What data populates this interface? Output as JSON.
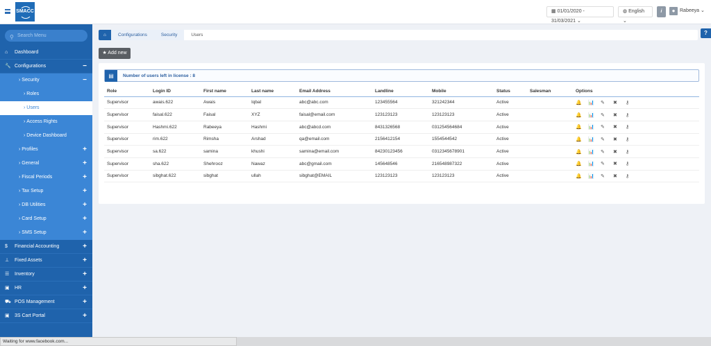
{
  "header": {
    "logo": "SMACC",
    "date_range": "01/01/2020 - 31/03/2021",
    "language": "English",
    "info": "i",
    "user": "Rabeeya"
  },
  "sidebar": {
    "search_placeholder": "Search Menu",
    "items": [
      {
        "label": "Dashboard",
        "level": "top",
        "icon": "home-icon"
      },
      {
        "label": "Configurations",
        "level": "top",
        "icon": "wrench-icon",
        "toggle": "−"
      },
      {
        "label": "Security",
        "level": "sub",
        "toggle": "−"
      },
      {
        "label": "Roles",
        "level": "sub2"
      },
      {
        "label": "Users",
        "level": "sub2",
        "active": true
      },
      {
        "label": "Access Rights",
        "level": "sub2"
      },
      {
        "label": "Device Dashboard",
        "level": "sub2"
      },
      {
        "label": "Profiles",
        "level": "sub",
        "toggle": "+"
      },
      {
        "label": "General",
        "level": "sub",
        "toggle": "+"
      },
      {
        "label": "Fiscal Periods",
        "level": "sub",
        "toggle": "+"
      },
      {
        "label": "Tax Setup",
        "level": "sub",
        "toggle": "+"
      },
      {
        "label": "DB Utilities",
        "level": "sub",
        "toggle": "+"
      },
      {
        "label": "Card Setup",
        "level": "sub",
        "toggle": "+"
      },
      {
        "label": "SMS Setup",
        "level": "sub",
        "toggle": "+"
      },
      {
        "label": "Financial Accounting",
        "level": "top",
        "icon": "dollar-icon",
        "toggle": "+"
      },
      {
        "label": "Fixed Assets",
        "level": "top",
        "icon": "pin-icon",
        "toggle": "+"
      },
      {
        "label": "Inventory",
        "level": "top",
        "icon": "list-icon",
        "toggle": "+"
      },
      {
        "label": "HR",
        "level": "top",
        "icon": "id-card-icon",
        "toggle": "+"
      },
      {
        "label": "POS Management",
        "level": "top",
        "icon": "cart-icon",
        "toggle": "+"
      },
      {
        "label": "3S Cart Portal",
        "level": "top",
        "icon": "id-card-icon",
        "toggle": "+"
      }
    ]
  },
  "breadcrumb": [
    "Configurations",
    "Security",
    "Users"
  ],
  "help": "?",
  "add_new": "Add new",
  "license_text": "Number of users left in license : 8",
  "table": {
    "columns": [
      "Role",
      "Login ID",
      "First name",
      "Last name",
      "Email Address",
      "Landline",
      "Mobile",
      "Status",
      "Salesman",
      "Options"
    ],
    "rows": [
      [
        "Supervisor",
        "awais.622",
        "Awais",
        "Iqbal",
        "abc@abc.com",
        "123455564",
        "321242344",
        "Active",
        ""
      ],
      [
        "Supervisor",
        "faisal.622",
        "Faisal",
        "XYZ",
        "faisal@email.com",
        "123123123",
        "123123123",
        "Active",
        ""
      ],
      [
        "Supervisor",
        "Hashmi.622",
        "Rabeeya",
        "Hashmi",
        "abc@abcd.com",
        "8431326568",
        "031254564684",
        "Active",
        ""
      ],
      [
        "Supervisor",
        "rim.622",
        "Rimsha",
        "Arshad",
        "qa@email.com",
        "2156412154",
        "1554544542",
        "Active",
        ""
      ],
      [
        "Supervisor",
        "sa.622",
        "samina",
        "khushi",
        "samina@email.com",
        "84230123456",
        "0312345678901",
        "Active",
        ""
      ],
      [
        "Supervisor",
        "sha.622",
        "Shehrooz",
        "Nawaz",
        "abc@gmail.com",
        "145648546",
        "216548987322",
        "Active",
        ""
      ],
      [
        "Supervisor",
        "sibghat.622",
        "sibghat",
        "ullah",
        "sibghat@EMAIL",
        "123123123",
        "123123123",
        "Active",
        ""
      ]
    ]
  },
  "status_bar": "Waiting for www.facebook.com..."
}
